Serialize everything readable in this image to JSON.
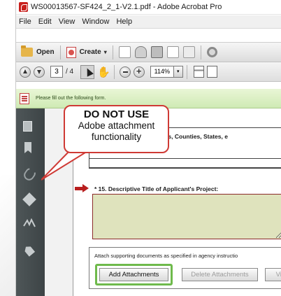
{
  "window": {
    "title": "WS00013567-SF424_2_1-V2.1.pdf - Adobe Acrobat Pro"
  },
  "menu": [
    "File",
    "Edit",
    "View",
    "Window",
    "Help"
  ],
  "toolbar": {
    "open_label": "Open",
    "create_label": "Create",
    "icons": [
      "save-icon",
      "cloud-icon",
      "print-icon",
      "edit-icon",
      "email-icon",
      "settings-icon"
    ]
  },
  "navigation": {
    "current_page": "3",
    "total_pages": "/ 4",
    "zoom": "114%"
  },
  "form_bar": {
    "message": "Please fill out the following form."
  },
  "callout": {
    "title": "DO NOT USE",
    "body_line1": "Adobe attachment",
    "body_line2": "functionality",
    "border_color": "#cf3a35"
  },
  "document": {
    "field14_label": "Project (Cities, Counties, States, e",
    "field15_label": "* 15. Descriptive Title of Applicant's Project:",
    "field15_value": "",
    "attach_instruction": "Attach supporting documents as specified in agency instructio",
    "buttons": {
      "add": "Add Attachments",
      "delete": "Delete Attachments",
      "view": "View A"
    },
    "highlight_color": "#6fba4c",
    "required_field_color": "#dfe3bd"
  },
  "nav_pane_icons": [
    "pages-icon",
    "bookmark-icon",
    "attachment-icon",
    "layers-icon",
    "signature-icon",
    "tag-icon"
  ]
}
